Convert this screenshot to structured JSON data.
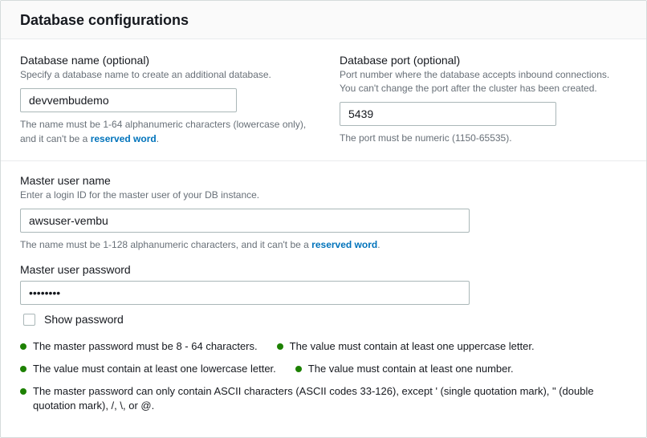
{
  "header": {
    "title": "Database configurations"
  },
  "dbName": {
    "label": "Database name (optional)",
    "desc": "Specify a database name to create an additional database.",
    "value": "devvembudemo",
    "helpPre": "The name must be 1-64 alphanumeric characters (lowercase only), and it can't be a ",
    "helpLink": "reserved word",
    "helpPost": "."
  },
  "dbPort": {
    "label": "Database port (optional)",
    "desc": "Port number where the database accepts inbound connections. You can't change the port after the cluster has been created.",
    "value": "5439",
    "help": "The port must be numeric (1150-65535)."
  },
  "masterUser": {
    "label": "Master user name",
    "desc": "Enter a login ID for the master user of your DB instance.",
    "value": "awsuser-vembu",
    "helpPre": "The name must be 1-128 alphanumeric characters, and it can't be a ",
    "helpLink": "reserved word",
    "helpPost": "."
  },
  "masterPassword": {
    "label": "Master user password",
    "value": "••••••••",
    "showPasswordLabel": "Show password"
  },
  "rules": {
    "r1": "The master password must be 8 - 64 characters.",
    "r2": "The value must contain at least one uppercase letter.",
    "r3": "The value must contain at least one lowercase letter.",
    "r4": "The value must contain at least one number.",
    "r5": "The master password can only contain ASCII characters (ASCII codes 33-126), except ' (single quotation mark), \" (double quotation mark), /, \\, or @."
  }
}
